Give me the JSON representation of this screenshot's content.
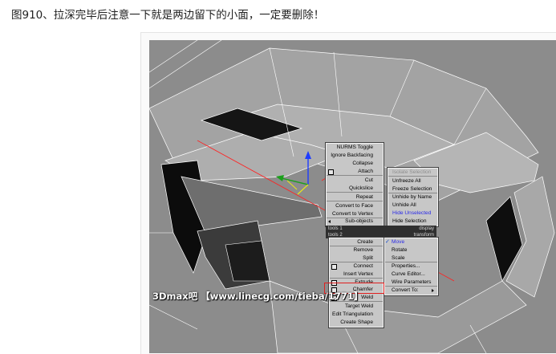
{
  "post": {
    "caption": "图910、拉深完毕后注意一下就是两边留下的小面，一定要删除！"
  },
  "watermark": "3Dmax吧 【www.linecg.com/tieba/1771】",
  "quad_menu": {
    "tools1": {
      "items": [
        {
          "label": "NURMS Toggle",
          "icon": ""
        },
        {
          "label": "Ignore Backfacing",
          "icon": ""
        },
        {
          "label": "Collapse",
          "icon": ""
        },
        {
          "label": "Attach",
          "icon": "settings-box-icon"
        },
        {
          "label": "Cut",
          "icon": ""
        },
        {
          "label": "Quickslice",
          "icon": ""
        },
        {
          "label": "Repeat",
          "icon": ""
        },
        {
          "label": "Convert to Face",
          "icon": ""
        },
        {
          "label": "Convert to Vertex",
          "icon": ""
        },
        {
          "label": "Sub-objects",
          "icon": "submenu-arrow-left-icon"
        }
      ],
      "header_left": "tools 1",
      "header_right": "display"
    },
    "display": {
      "items": [
        {
          "label": "Isolate Selection",
          "state": "disabled"
        },
        {
          "label": "Unfreeze All",
          "state": "normal"
        },
        {
          "label": "Freeze Selection",
          "state": "normal"
        },
        {
          "label": "Unhide by Name",
          "state": "normal"
        },
        {
          "label": "Unhide All",
          "state": "normal"
        },
        {
          "label": "Hide Unselected",
          "state": "highlighted"
        },
        {
          "label": "Hide Selection",
          "state": "normal"
        }
      ]
    },
    "tools2": {
      "header_left": "tools 2",
      "header_right": "transform",
      "items": [
        {
          "label": "Create",
          "icon": ""
        },
        {
          "label": "Remove",
          "icon": ""
        },
        {
          "label": "Split",
          "icon": ""
        },
        {
          "label": "Connect",
          "icon": "settings-box-icon"
        },
        {
          "label": "Insert Vertex",
          "icon": ""
        },
        {
          "label": "Extrude",
          "icon": "settings-box-icon"
        },
        {
          "label": "Chamfer",
          "icon": "settings-box-icon"
        },
        {
          "label": "Weld",
          "icon": "settings-box-icon"
        },
        {
          "label": "Target Weld",
          "icon": ""
        },
        {
          "label": "Edit Triangulation",
          "icon": ""
        },
        {
          "label": "Create Shape",
          "icon": ""
        }
      ]
    },
    "transform": {
      "items": [
        {
          "label": "Move",
          "checked": true,
          "highlight": true
        },
        {
          "label": "Rotate",
          "checked": false
        },
        {
          "label": "Scale",
          "checked": false
        },
        {
          "label": "Properties...",
          "checked": false
        },
        {
          "label": "Curve Editor...",
          "checked": false
        },
        {
          "label": "Wire Parameters",
          "checked": false
        },
        {
          "label": "Convert To:",
          "checked": false,
          "submenu": true
        }
      ],
      "check_mark": "✓",
      "highlight_color": "#2a2ae8"
    }
  },
  "colors": {
    "viewport_bg": "#8c8c8c",
    "menu_bg": "#c7c7c7",
    "header_bg": "#2f2f2f",
    "annotation_red": "#e02020",
    "edge_selection": "#ff2222"
  }
}
